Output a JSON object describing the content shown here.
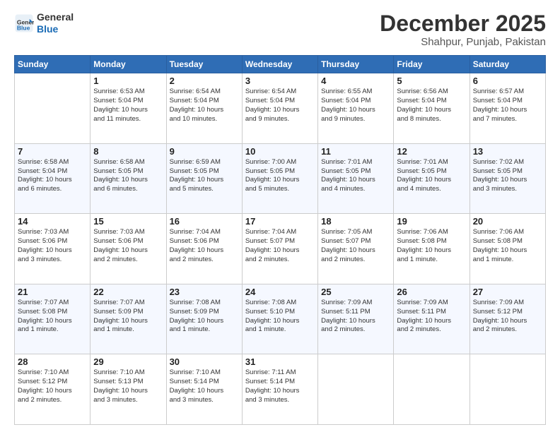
{
  "logo": {
    "line1": "General",
    "line2": "Blue"
  },
  "title": "December 2025",
  "subtitle": "Shahpur, Punjab, Pakistan",
  "days_of_week": [
    "Sunday",
    "Monday",
    "Tuesday",
    "Wednesday",
    "Thursday",
    "Friday",
    "Saturday"
  ],
  "weeks": [
    [
      {
        "day": "",
        "info": ""
      },
      {
        "day": "1",
        "info": "Sunrise: 6:53 AM\nSunset: 5:04 PM\nDaylight: 10 hours\nand 11 minutes."
      },
      {
        "day": "2",
        "info": "Sunrise: 6:54 AM\nSunset: 5:04 PM\nDaylight: 10 hours\nand 10 minutes."
      },
      {
        "day": "3",
        "info": "Sunrise: 6:54 AM\nSunset: 5:04 PM\nDaylight: 10 hours\nand 9 minutes."
      },
      {
        "day": "4",
        "info": "Sunrise: 6:55 AM\nSunset: 5:04 PM\nDaylight: 10 hours\nand 9 minutes."
      },
      {
        "day": "5",
        "info": "Sunrise: 6:56 AM\nSunset: 5:04 PM\nDaylight: 10 hours\nand 8 minutes."
      },
      {
        "day": "6",
        "info": "Sunrise: 6:57 AM\nSunset: 5:04 PM\nDaylight: 10 hours\nand 7 minutes."
      }
    ],
    [
      {
        "day": "7",
        "info": "Sunrise: 6:58 AM\nSunset: 5:04 PM\nDaylight: 10 hours\nand 6 minutes."
      },
      {
        "day": "8",
        "info": "Sunrise: 6:58 AM\nSunset: 5:05 PM\nDaylight: 10 hours\nand 6 minutes."
      },
      {
        "day": "9",
        "info": "Sunrise: 6:59 AM\nSunset: 5:05 PM\nDaylight: 10 hours\nand 5 minutes."
      },
      {
        "day": "10",
        "info": "Sunrise: 7:00 AM\nSunset: 5:05 PM\nDaylight: 10 hours\nand 5 minutes."
      },
      {
        "day": "11",
        "info": "Sunrise: 7:01 AM\nSunset: 5:05 PM\nDaylight: 10 hours\nand 4 minutes."
      },
      {
        "day": "12",
        "info": "Sunrise: 7:01 AM\nSunset: 5:05 PM\nDaylight: 10 hours\nand 4 minutes."
      },
      {
        "day": "13",
        "info": "Sunrise: 7:02 AM\nSunset: 5:05 PM\nDaylight: 10 hours\nand 3 minutes."
      }
    ],
    [
      {
        "day": "14",
        "info": "Sunrise: 7:03 AM\nSunset: 5:06 PM\nDaylight: 10 hours\nand 3 minutes."
      },
      {
        "day": "15",
        "info": "Sunrise: 7:03 AM\nSunset: 5:06 PM\nDaylight: 10 hours\nand 2 minutes."
      },
      {
        "day": "16",
        "info": "Sunrise: 7:04 AM\nSunset: 5:06 PM\nDaylight: 10 hours\nand 2 minutes."
      },
      {
        "day": "17",
        "info": "Sunrise: 7:04 AM\nSunset: 5:07 PM\nDaylight: 10 hours\nand 2 minutes."
      },
      {
        "day": "18",
        "info": "Sunrise: 7:05 AM\nSunset: 5:07 PM\nDaylight: 10 hours\nand 2 minutes."
      },
      {
        "day": "19",
        "info": "Sunrise: 7:06 AM\nSunset: 5:08 PM\nDaylight: 10 hours\nand 1 minute."
      },
      {
        "day": "20",
        "info": "Sunrise: 7:06 AM\nSunset: 5:08 PM\nDaylight: 10 hours\nand 1 minute."
      }
    ],
    [
      {
        "day": "21",
        "info": "Sunrise: 7:07 AM\nSunset: 5:08 PM\nDaylight: 10 hours\nand 1 minute."
      },
      {
        "day": "22",
        "info": "Sunrise: 7:07 AM\nSunset: 5:09 PM\nDaylight: 10 hours\nand 1 minute."
      },
      {
        "day": "23",
        "info": "Sunrise: 7:08 AM\nSunset: 5:09 PM\nDaylight: 10 hours\nand 1 minute."
      },
      {
        "day": "24",
        "info": "Sunrise: 7:08 AM\nSunset: 5:10 PM\nDaylight: 10 hours\nand 1 minute."
      },
      {
        "day": "25",
        "info": "Sunrise: 7:09 AM\nSunset: 5:11 PM\nDaylight: 10 hours\nand 2 minutes."
      },
      {
        "day": "26",
        "info": "Sunrise: 7:09 AM\nSunset: 5:11 PM\nDaylight: 10 hours\nand 2 minutes."
      },
      {
        "day": "27",
        "info": "Sunrise: 7:09 AM\nSunset: 5:12 PM\nDaylight: 10 hours\nand 2 minutes."
      }
    ],
    [
      {
        "day": "28",
        "info": "Sunrise: 7:10 AM\nSunset: 5:12 PM\nDaylight: 10 hours\nand 2 minutes."
      },
      {
        "day": "29",
        "info": "Sunrise: 7:10 AM\nSunset: 5:13 PM\nDaylight: 10 hours\nand 3 minutes."
      },
      {
        "day": "30",
        "info": "Sunrise: 7:10 AM\nSunset: 5:14 PM\nDaylight: 10 hours\nand 3 minutes."
      },
      {
        "day": "31",
        "info": "Sunrise: 7:11 AM\nSunset: 5:14 PM\nDaylight: 10 hours\nand 3 minutes."
      },
      {
        "day": "",
        "info": ""
      },
      {
        "day": "",
        "info": ""
      },
      {
        "day": "",
        "info": ""
      }
    ]
  ]
}
